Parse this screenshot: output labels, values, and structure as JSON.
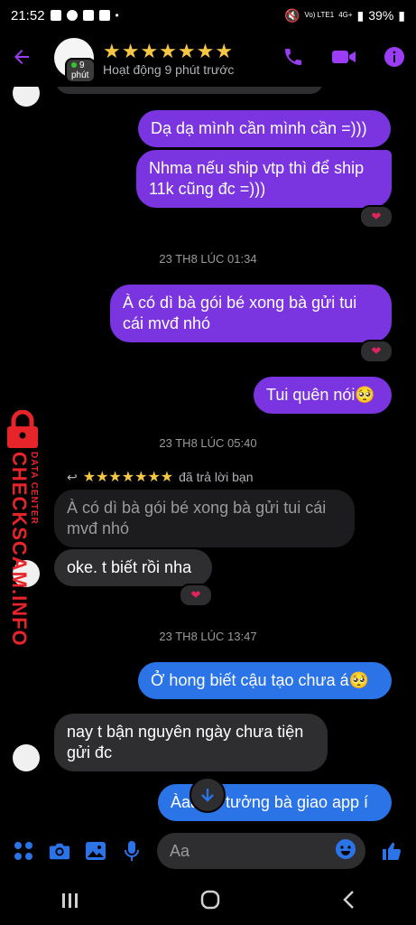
{
  "status_bar": {
    "time": "21:52",
    "network": "Vo) LTE1",
    "network2": "4G+",
    "battery": "39%"
  },
  "header": {
    "contact_name": "★★★★★★★",
    "active_pill": "9 phút",
    "activity": "Hoạt động 9 phút trước"
  },
  "messages": {
    "m1": "Dạ dạ mình cần mình cần =)))",
    "m2": "Nhma nếu ship vtp thì để ship 11k cũng đc =)))",
    "ts1": "23 TH8 LÚC 01:34",
    "m3": "À có dì bà gói bé xong bà gửi tui cái mvđ nhó",
    "m4": "Tui quên nói",
    "ts2": "23 TH8 LÚC 05:40",
    "reply_name": "★★★★★★★",
    "reply_label": "đã trả lời bạn",
    "quoted": "À có dì bà gói bé xong bà gửi tui cái mvđ nhó",
    "m5": "oke. t biết rồi nha",
    "ts3": "23 TH8 LÚC 13:47",
    "m6": "Ở hong biết cậu tạo chưa á",
    "m7": "nay t bận nguyên ngày chưa tiện gửi đc",
    "m8": "Àaa tui tưởng bà giao app í"
  },
  "composer": {
    "placeholder": "Aa"
  },
  "watermark": {
    "name": "CHECKSCAM.INFO",
    "sub": "DATA CENTER"
  },
  "colors": {
    "accent": "#9b3cf7",
    "outgoing_purple": "#7a34e0",
    "outgoing_blue": "#2b74e8",
    "incoming": "#2e2e30",
    "stars": "#f6c744",
    "watermark_red": "#e62429"
  },
  "icons": [
    "back-arrow-icon",
    "phone-icon",
    "video-icon",
    "info-icon",
    "heart-icon",
    "reply-icon",
    "down-arrow-icon",
    "grid-icon",
    "camera-icon",
    "image-icon",
    "mic-icon",
    "emoji-icon",
    "like-icon",
    "recents-icon",
    "home-icon",
    "nav-back-icon"
  ]
}
